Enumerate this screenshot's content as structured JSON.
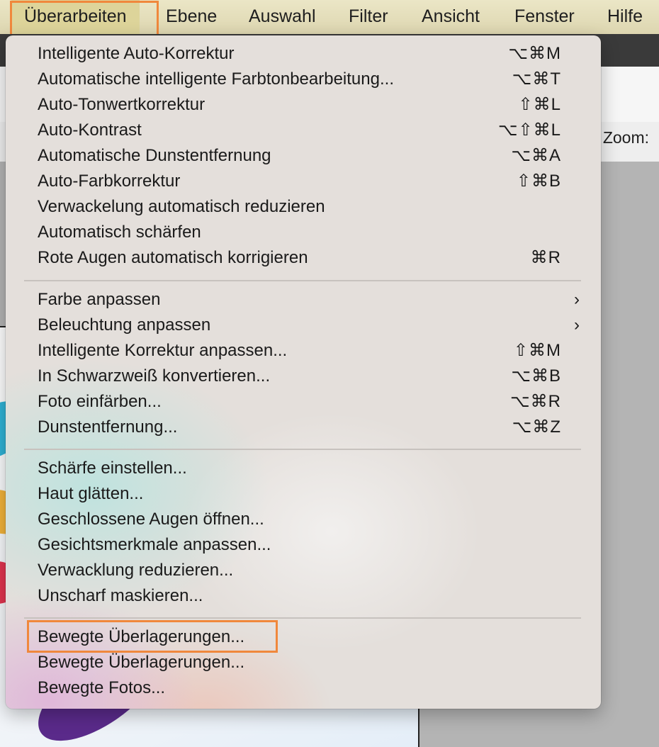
{
  "menubar": {
    "items": [
      "Überarbeiten",
      "Ebene",
      "Auswahl",
      "Filter",
      "Ansicht",
      "Fenster",
      "Hilfe"
    ],
    "active_index": 0
  },
  "options_bar": {
    "zoom_label": "Zoom:"
  },
  "menu": {
    "groups": [
      [
        {
          "label": "Intelligente Auto-Korrektur",
          "shortcut": "⌥⌘M"
        },
        {
          "label": "Automatische intelligente Farbtonbearbeitung...",
          "shortcut": "⌥⌘T"
        },
        {
          "label": "Auto-Tonwertkorrektur",
          "shortcut": "⇧⌘L"
        },
        {
          "label": "Auto-Kontrast",
          "shortcut": "⌥⇧⌘L"
        },
        {
          "label": "Automatische Dunstentfernung",
          "shortcut": "⌥⌘A"
        },
        {
          "label": "Auto-Farbkorrektur",
          "shortcut": "⇧⌘B"
        },
        {
          "label": "Verwackelung automatisch reduzieren",
          "shortcut": ""
        },
        {
          "label": "Automatisch schärfen",
          "shortcut": ""
        },
        {
          "label": "Rote Augen automatisch korrigieren",
          "shortcut": "⌘R"
        }
      ],
      [
        {
          "label": "Farbe anpassen",
          "shortcut": "",
          "submenu": "›"
        },
        {
          "label": "Beleuchtung anpassen",
          "shortcut": "",
          "submenu": "›"
        },
        {
          "label": "Intelligente Korrektur anpassen...",
          "shortcut": "⇧⌘M"
        },
        {
          "label": "In Schwarzweiß konvertieren...",
          "shortcut": "⌥⌘B"
        },
        {
          "label": "Foto einfärben...",
          "shortcut": "⌥⌘R"
        },
        {
          "label": "Dunstentfernung...",
          "shortcut": "⌥⌘Z"
        }
      ],
      [
        {
          "label": "Schärfe einstellen...",
          "shortcut": ""
        },
        {
          "label": "Haut glätten...",
          "shortcut": ""
        },
        {
          "label": "Geschlossene Augen öffnen...",
          "shortcut": ""
        },
        {
          "label": "Gesichtsmerkmale anpassen...",
          "shortcut": ""
        },
        {
          "label": "Verwacklung reduzieren...",
          "shortcut": ""
        },
        {
          "label": "Unscharf maskieren...",
          "shortcut": ""
        }
      ],
      [
        {
          "label": "Bewegte Überlagerungen...",
          "shortcut": "",
          "highlighted": true
        },
        {
          "label": "Bewegte Überlagerungen...",
          "shortcut": ""
        },
        {
          "label": "Bewegte Fotos...",
          "shortcut": ""
        }
      ]
    ]
  },
  "colors": {
    "highlight_outline": "#f0883c",
    "menubar_bg": "#e4ddb8",
    "menu_text": "#1a1a1a"
  }
}
